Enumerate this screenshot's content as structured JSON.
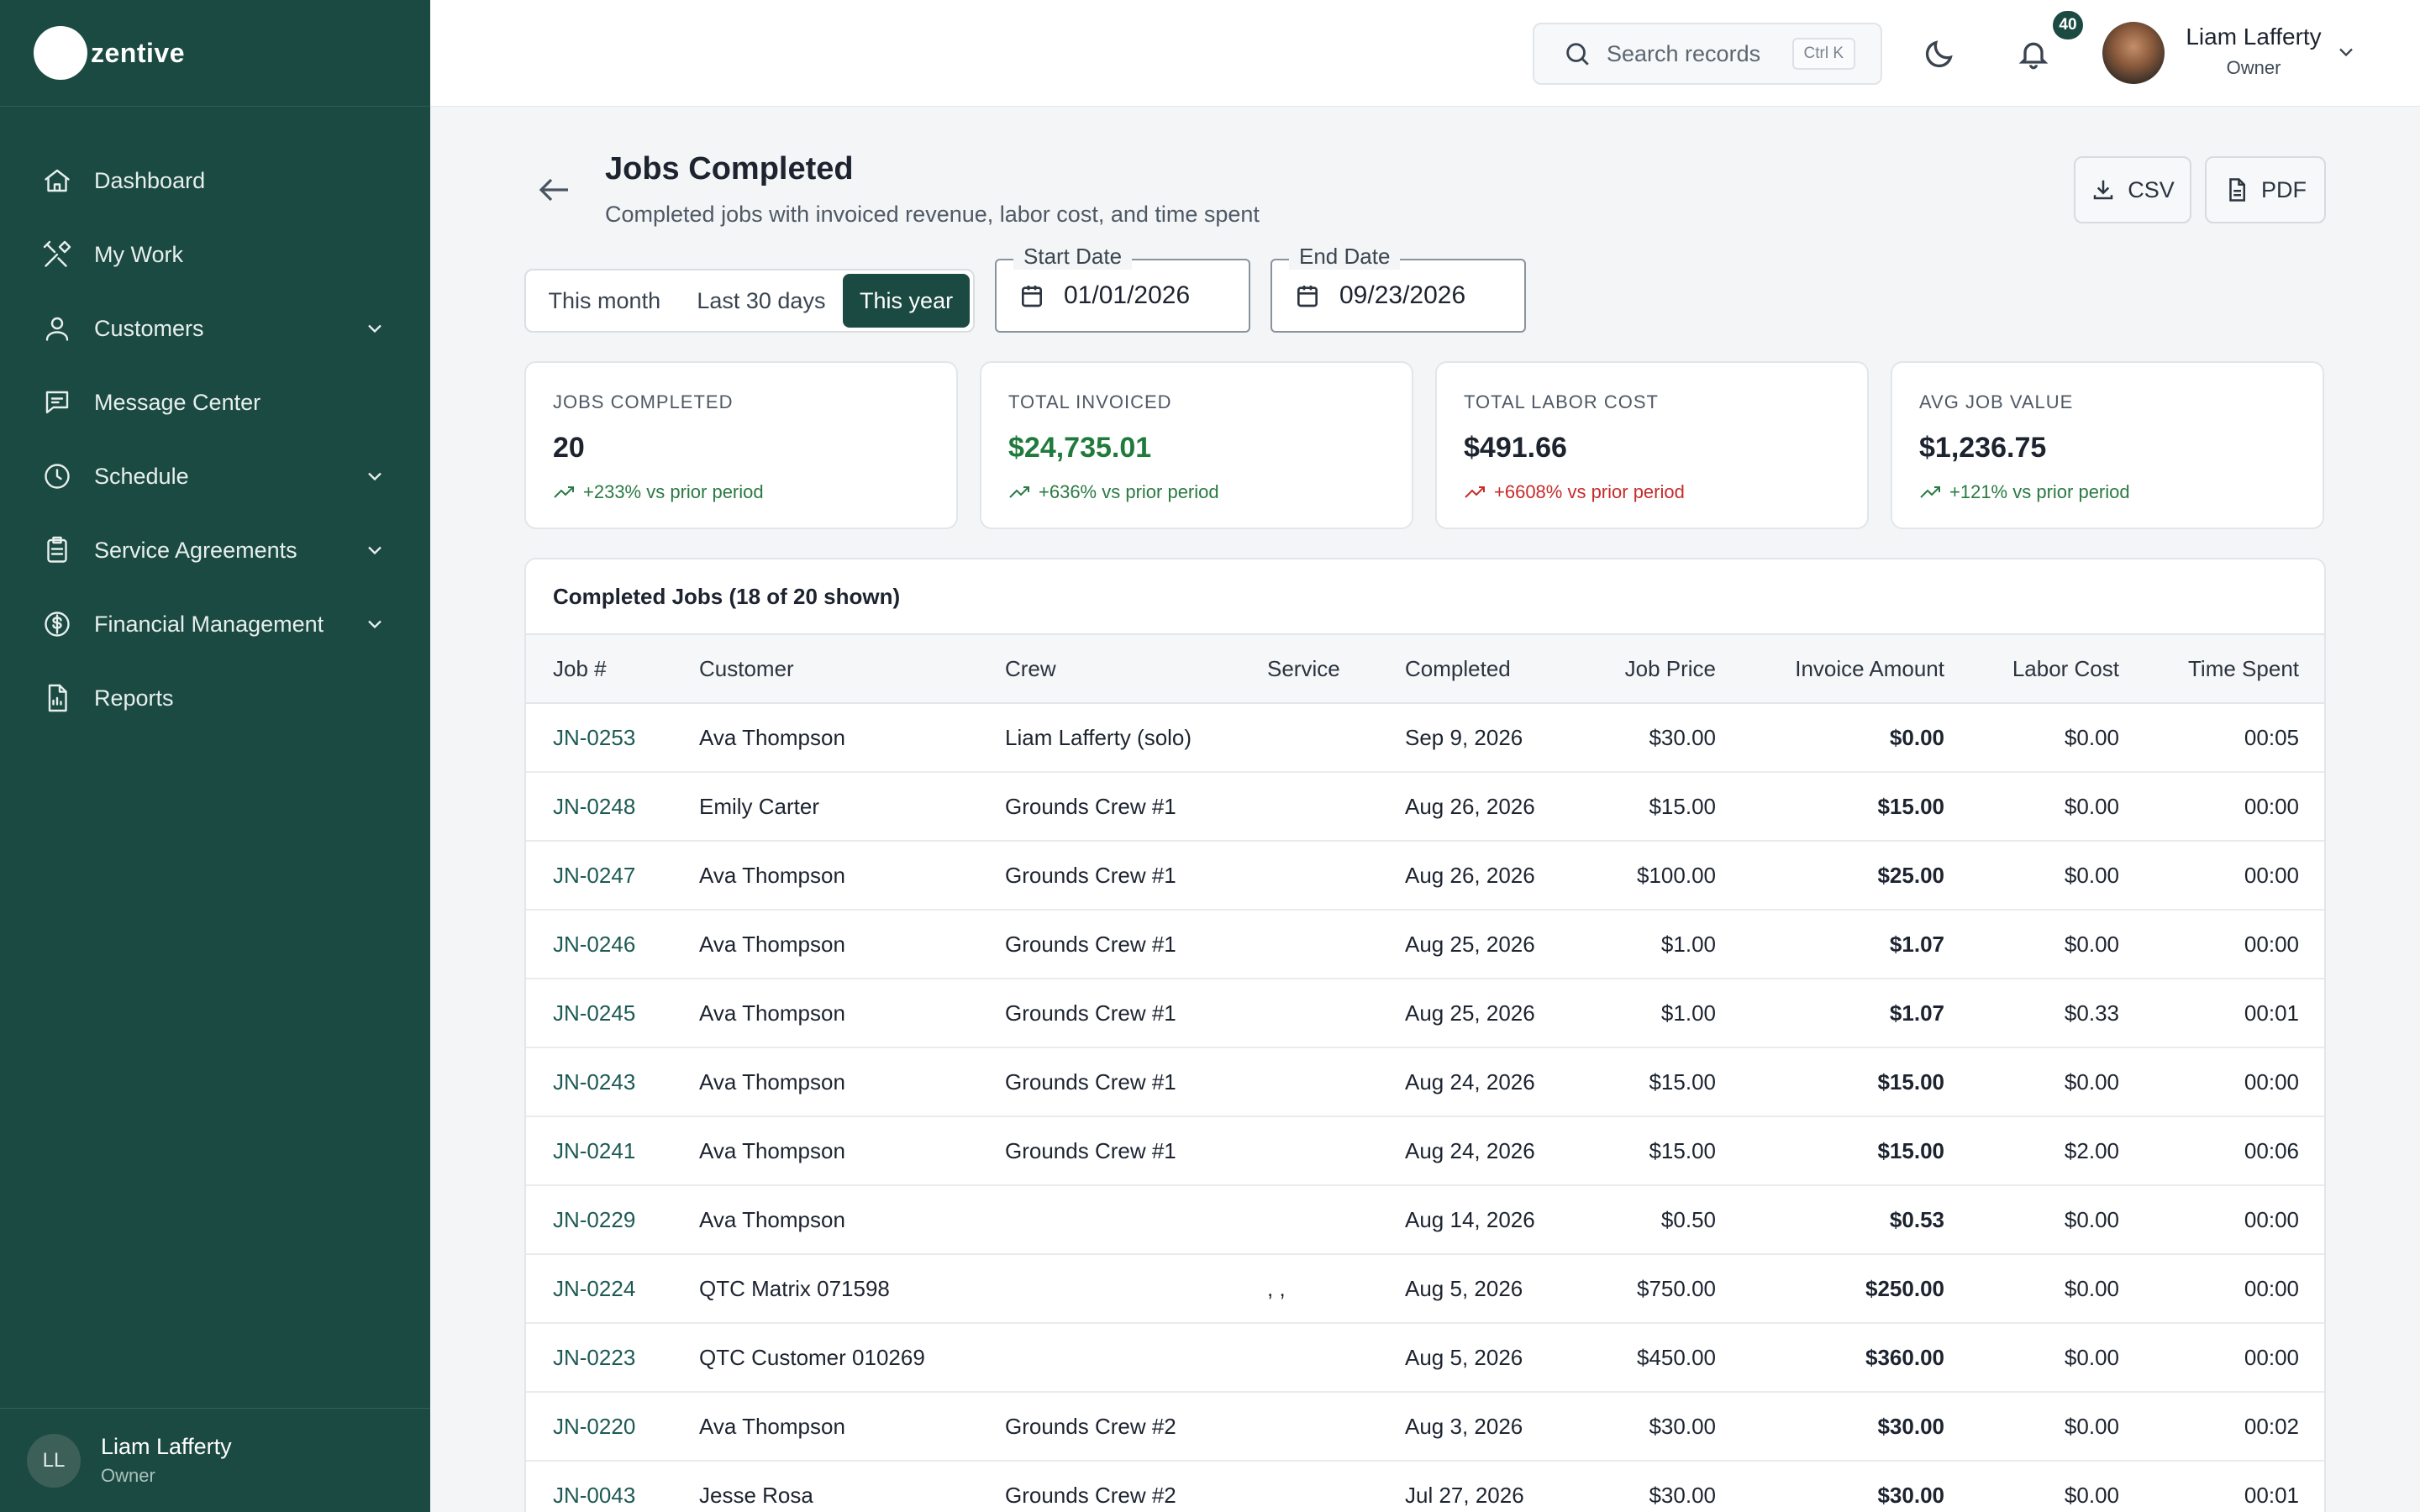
{
  "app": {
    "logo_text": "zentive"
  },
  "sidebar": {
    "items": [
      {
        "label": "Dashboard",
        "icon": "home-icon",
        "expandable": false
      },
      {
        "label": "My Work",
        "icon": "tools-icon",
        "expandable": false
      },
      {
        "label": "Customers",
        "icon": "users-icon",
        "expandable": true
      },
      {
        "label": "Message Center",
        "icon": "chat-icon",
        "expandable": false
      },
      {
        "label": "Schedule",
        "icon": "clock-icon",
        "expandable": true
      },
      {
        "label": "Service Agreements",
        "icon": "clipboard-icon",
        "expandable": true
      },
      {
        "label": "Financial Management",
        "icon": "dollar-icon",
        "expandable": true
      },
      {
        "label": "Reports",
        "icon": "report-icon",
        "expandable": false
      }
    ],
    "user": {
      "initials": "LL",
      "name": "Liam Lafferty",
      "role": "Owner"
    }
  },
  "topbar": {
    "search_placeholder": "Search records",
    "search_shortcut": "Ctrl K",
    "notification_count": "40",
    "user_name": "Liam Lafferty",
    "user_role": "Owner"
  },
  "page": {
    "title": "Jobs Completed",
    "subtitle": "Completed jobs with invoiced revenue, labor cost, and time spent",
    "csv_label": "CSV",
    "pdf_label": "PDF"
  },
  "filters": {
    "ranges": [
      "This month",
      "Last 30 days",
      "This year"
    ],
    "selected_range": "This year",
    "start_label": "Start Date",
    "start_value": "01/01/2026",
    "end_label": "End Date",
    "end_value": "09/23/2026"
  },
  "stats": [
    {
      "label": "JOBS COMPLETED",
      "value": "20",
      "trend": "+233% vs prior period",
      "trend_dir": "good"
    },
    {
      "label": "TOTAL INVOICED",
      "value": "$24,735.01",
      "trend": "+636% vs prior period",
      "trend_dir": "good"
    },
    {
      "label": "TOTAL LABOR COST",
      "value": "$491.66",
      "trend": "+6608% vs prior period",
      "trend_dir": "bad"
    },
    {
      "label": "AVG JOB VALUE",
      "value": "$1,236.75",
      "trend": "+121% vs prior period",
      "trend_dir": "good"
    }
  ],
  "colors": {
    "sidebar_bg": "#1b4a42",
    "accent": "#1b4a42",
    "positive": "#2a7a43",
    "negative": "#c62b2b",
    "link": "#1d5a55"
  },
  "table": {
    "title": "Completed Jobs (18 of 20 shown)",
    "columns": [
      "Job #",
      "Customer",
      "Crew",
      "Service",
      "Completed",
      "Job Price",
      "Invoice Amount",
      "Labor Cost",
      "Time Spent"
    ],
    "rows": [
      [
        "JN-0253",
        "Ava Thompson",
        "Liam Lafferty (solo)",
        "",
        "Sep 9, 2026",
        "$30.00",
        "$0.00",
        "$0.00",
        "00:05"
      ],
      [
        "JN-0248",
        "Emily Carter",
        "Grounds Crew #1",
        "",
        "Aug 26, 2026",
        "$15.00",
        "$15.00",
        "$0.00",
        "00:00"
      ],
      [
        "JN-0247",
        "Ava Thompson",
        "Grounds Crew #1",
        "",
        "Aug 26, 2026",
        "$100.00",
        "$25.00",
        "$0.00",
        "00:00"
      ],
      [
        "JN-0246",
        "Ava Thompson",
        "Grounds Crew #1",
        "",
        "Aug 25, 2026",
        "$1.00",
        "$1.07",
        "$0.00",
        "00:00"
      ],
      [
        "JN-0245",
        "Ava Thompson",
        "Grounds Crew #1",
        "",
        "Aug 25, 2026",
        "$1.00",
        "$1.07",
        "$0.33",
        "00:01"
      ],
      [
        "JN-0243",
        "Ava Thompson",
        "Grounds Crew #1",
        "",
        "Aug 24, 2026",
        "$15.00",
        "$15.00",
        "$0.00",
        "00:00"
      ],
      [
        "JN-0241",
        "Ava Thompson",
        "Grounds Crew #1",
        "",
        "Aug 24, 2026",
        "$15.00",
        "$15.00",
        "$2.00",
        "00:06"
      ],
      [
        "JN-0229",
        "Ava Thompson",
        "",
        "",
        "Aug 14, 2026",
        "$0.50",
        "$0.53",
        "$0.00",
        "00:00"
      ],
      [
        "JN-0224",
        "QTC Matrix 071598",
        "",
        ", ,",
        "Aug 5, 2026",
        "$750.00",
        "$250.00",
        "$0.00",
        "00:00"
      ],
      [
        "JN-0223",
        "QTC Customer 010269",
        "",
        "",
        "Aug 5, 2026",
        "$450.00",
        "$360.00",
        "$0.00",
        "00:00"
      ],
      [
        "JN-0220",
        "Ava Thompson",
        "Grounds Crew #2",
        "",
        "Aug 3, 2026",
        "$30.00",
        "$30.00",
        "$0.00",
        "00:02"
      ],
      [
        "JN-0043",
        "Jesse Rosa",
        "Grounds Crew #2",
        "",
        "Jul 27, 2026",
        "$30.00",
        "$30.00",
        "$0.00",
        "00:01"
      ]
    ]
  }
}
